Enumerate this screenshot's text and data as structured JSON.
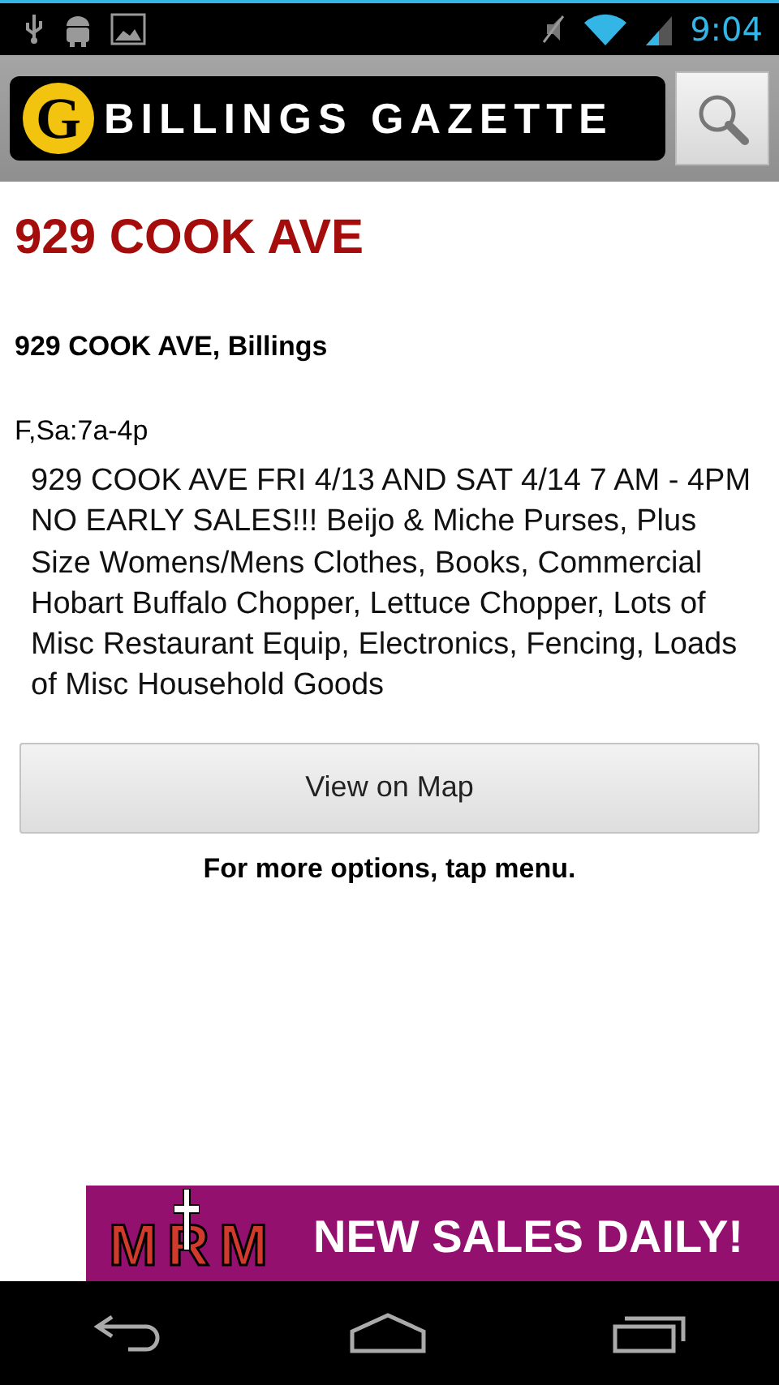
{
  "status_bar": {
    "time": "9:04"
  },
  "header": {
    "logo_mark": "G",
    "logo_text": "BILLINGS GAZETTE"
  },
  "listing": {
    "title": "929 COOK AVE",
    "address": "929 COOK AVE, Billings",
    "hours": "F,Sa:7a-4p",
    "description": "929 COOK AVE FRI 4/13 AND SAT 4/14 7 AM - 4PM NO EARLY SALES!!! Beijo & Miche Purses, Plus Size Womens/Mens Clothes, Books, Commercial Hobart Buffalo Chopper, Lettuce Chopper, Lots of Misc Restaurant Equip, Electronics, Fencing, Loads of Misc Household Goods"
  },
  "map_button": "View on Map",
  "hint": "For more options, tap menu.",
  "ad": {
    "logo": "MRM",
    "headline": "NEW SALES DAILY!"
  }
}
